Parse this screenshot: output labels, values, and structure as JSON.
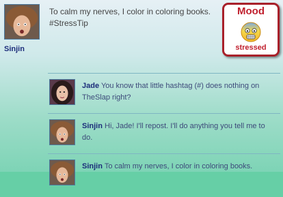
{
  "status": {
    "author": "Sinjin",
    "text_line1": "To calm my nerves, I color in coloring books.",
    "text_line2": "#StressTip"
  },
  "mood": {
    "title": "Mood",
    "label": "stressed",
    "icon": "anxious-face-icon",
    "color": "#c0202e"
  },
  "replies": [
    {
      "author": "Jade",
      "text": "You know that little hashtag (#) does nothing on TheSlap right?"
    },
    {
      "author": "Sinjin",
      "text": "Hi, Jade! I'll repost. I'll do anything you tell me to do."
    },
    {
      "author": "Sinjin",
      "text": "To calm my nerves, I color in coloring books."
    }
  ]
}
